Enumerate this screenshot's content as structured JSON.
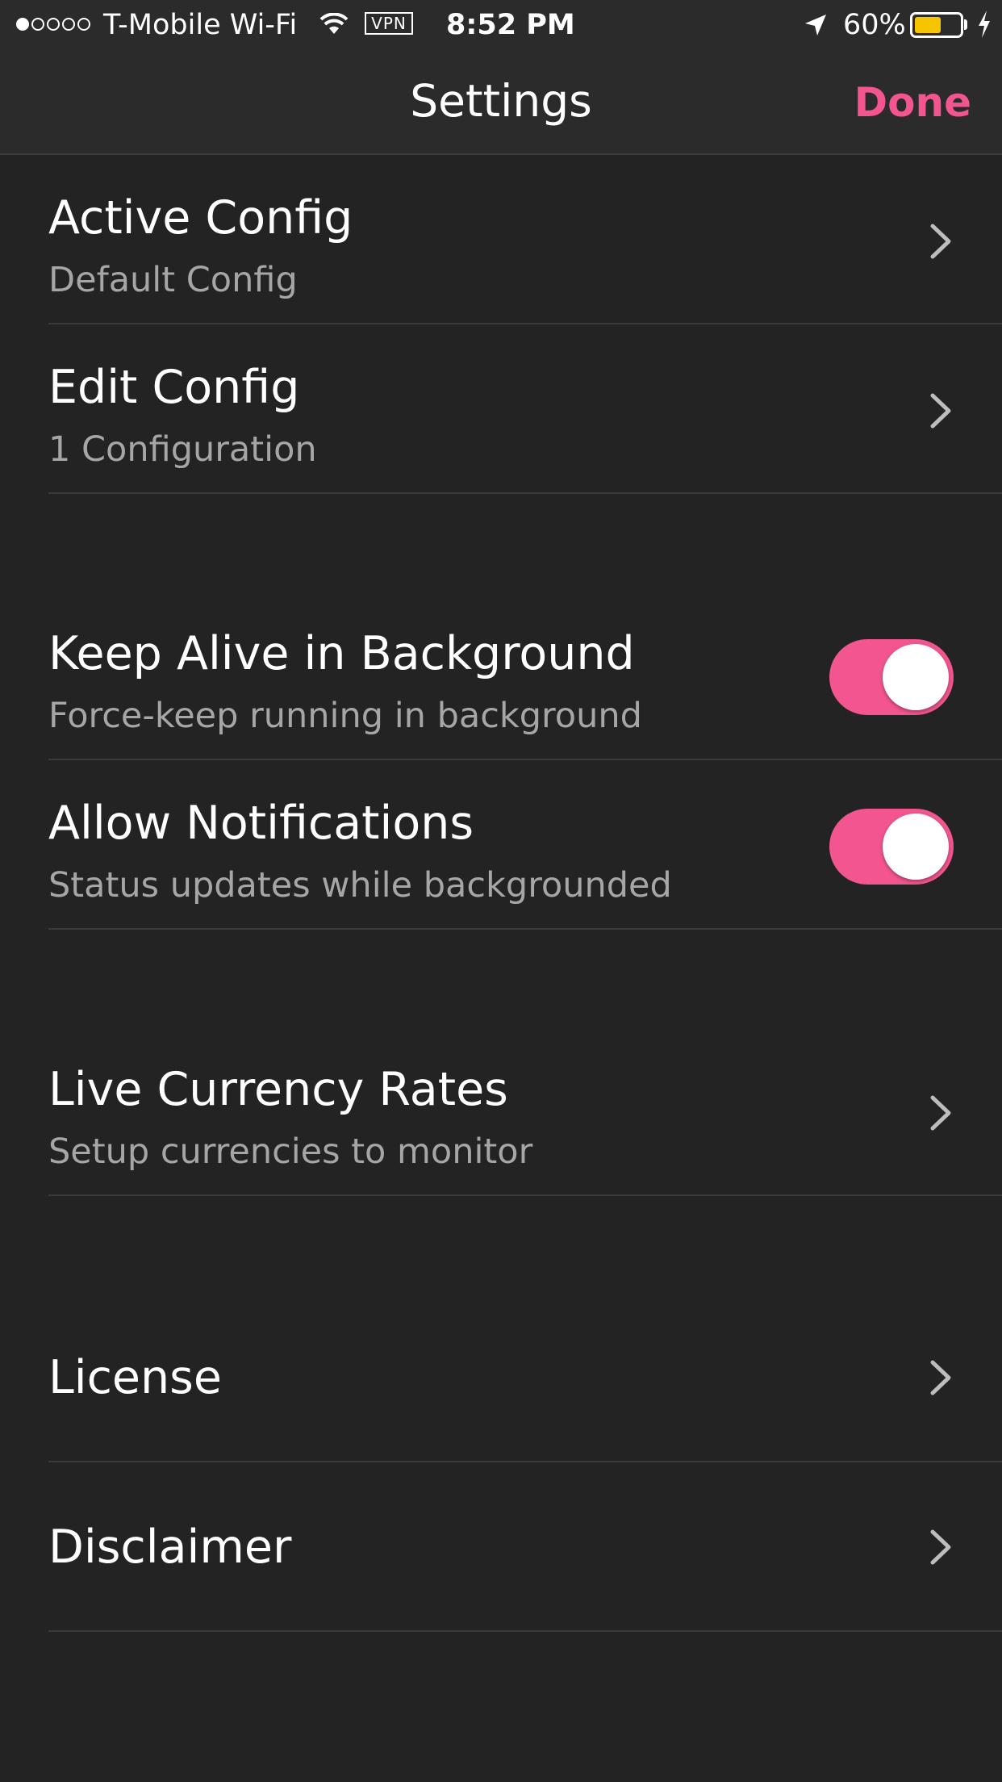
{
  "status_bar": {
    "signal_dots": [
      true,
      false,
      false,
      false,
      false
    ],
    "carrier": "T-Mobile Wi-Fi",
    "wifi_icon": "wifi-icon",
    "vpn": "VPN",
    "time": "8:52 PM",
    "location_icon": "location-arrow-icon",
    "battery_percent": "60%",
    "battery_level": 0.6,
    "battery_color": "#f7c400",
    "charging_icon": "charging-bolt-icon"
  },
  "nav": {
    "title": "Settings",
    "done_label": "Done",
    "accent_color": "#f2558f"
  },
  "sections": [
    {
      "rows": [
        {
          "title": "Active Config",
          "subtitle": "Default Config",
          "accessory": "chevron-right-icon"
        },
        {
          "title": "Edit Config",
          "subtitle": "1 Configuration",
          "accessory": "chevron-right-icon"
        }
      ]
    },
    {
      "rows": [
        {
          "title": "Keep Alive in Background",
          "subtitle": "Force-keep running in background",
          "accessory": "toggle",
          "toggle_on": true
        },
        {
          "title": "Allow Notifications",
          "subtitle": "Status updates while backgrounded",
          "accessory": "toggle",
          "toggle_on": true
        }
      ]
    },
    {
      "rows": [
        {
          "title": "Live Currency Rates",
          "subtitle": "Setup currencies to monitor",
          "accessory": "chevron-right-icon"
        }
      ]
    },
    {
      "rows": [
        {
          "title": "License",
          "accessory": "chevron-right-icon"
        },
        {
          "title": "Disclaimer",
          "accessory": "chevron-right-icon"
        }
      ]
    }
  ]
}
